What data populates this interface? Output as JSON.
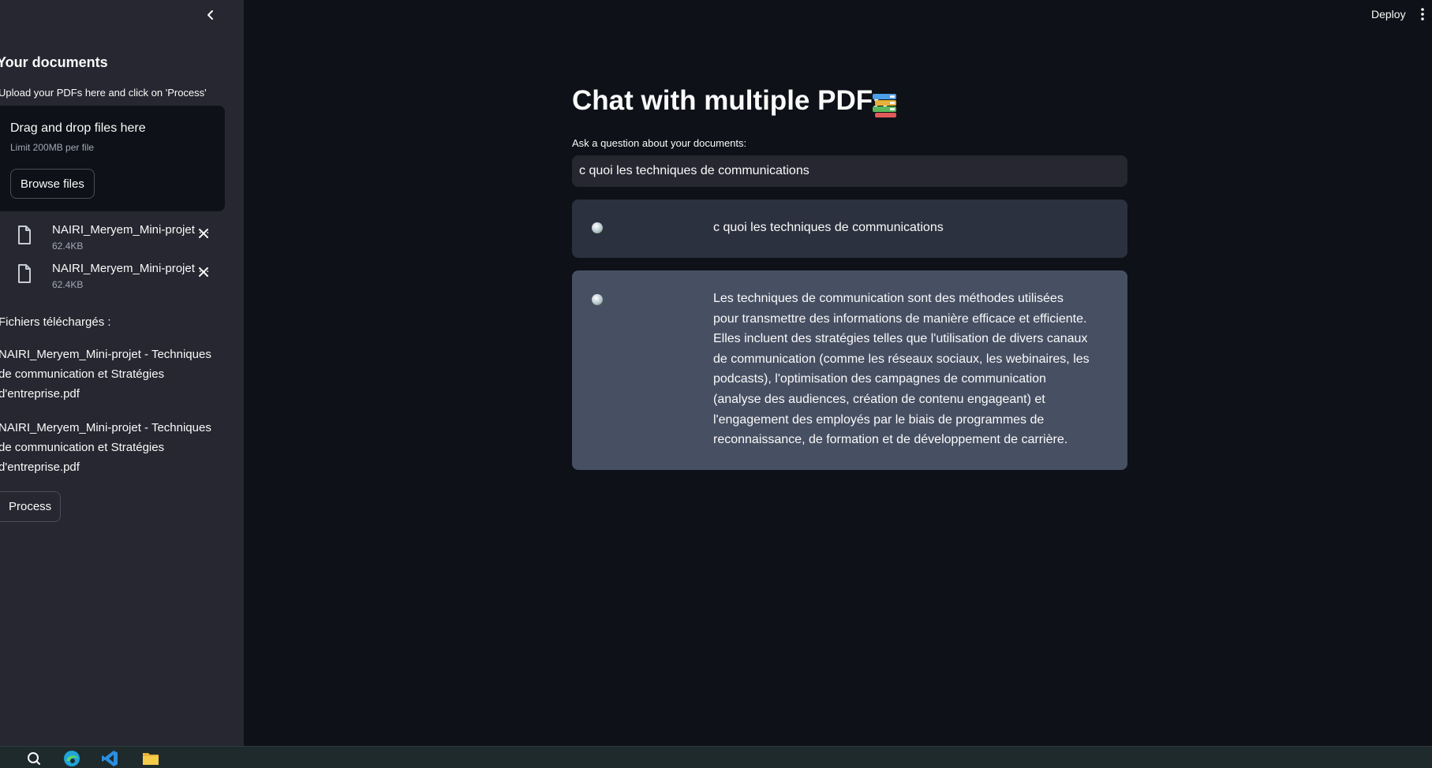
{
  "sidebar": {
    "title": "Your documents",
    "hint": "Upload your PDFs here and click on 'Process'",
    "dropzone": {
      "text": "Drag and drop files here",
      "limit": "Limit 200MB per file",
      "browse_label": "Browse files"
    },
    "files": [
      {
        "name": "NAIRI_Meryem_Mini-projet - Techniques de communication et Stratégies d'entreprise.pdf",
        "size": "62.4KB"
      },
      {
        "name": "NAIRI_Meryem_Mini-projet - Techniques de communication et Stratégies d'entreprise.pdf",
        "size": "62.4KB"
      }
    ],
    "downloaded_label": "Fichiers téléchargés :",
    "downloaded_files": [
      "NAIRI_Meryem_Mini-projet - Techniques de communication et Stratégies d'entreprise.pdf",
      "NAIRI_Meryem_Mini-projet - Techniques de communication et Stratégies d'entreprise.pdf"
    ],
    "process_label": "Process"
  },
  "header": {
    "deploy_label": "Deploy"
  },
  "main": {
    "title": "Chat with multiple PDFs",
    "question_label": "Ask a question about your documents:",
    "question_value": "c quoi les techniques de communications",
    "messages": [
      {
        "role": "user",
        "text": "c quoi les techniques de communications"
      },
      {
        "role": "bot",
        "text": "Les techniques de communication sont des méthodes utilisées pour transmettre des informations de manière efficace et efficiente. Elles incluent des stratégies telles que l'utilisation de divers canaux de communication (comme les réseaux sociaux, les webinaires, les podcasts), l'optimisation des campagnes de communication (analyse des audiences, création de contenu engageant) et l'engagement des employés par le biais de programmes de reconnaissance, de formation et de développement de carrière."
      }
    ]
  },
  "taskbar": {
    "icons": [
      "search-icon",
      "edge-browser-icon",
      "vscode-icon",
      "file-explorer-icon"
    ]
  },
  "colors": {
    "app_background": "#0e1117",
    "sidebar_background": "#262730",
    "user_message": "#2b313e",
    "bot_message": "#475063",
    "text": "#fafafa"
  }
}
